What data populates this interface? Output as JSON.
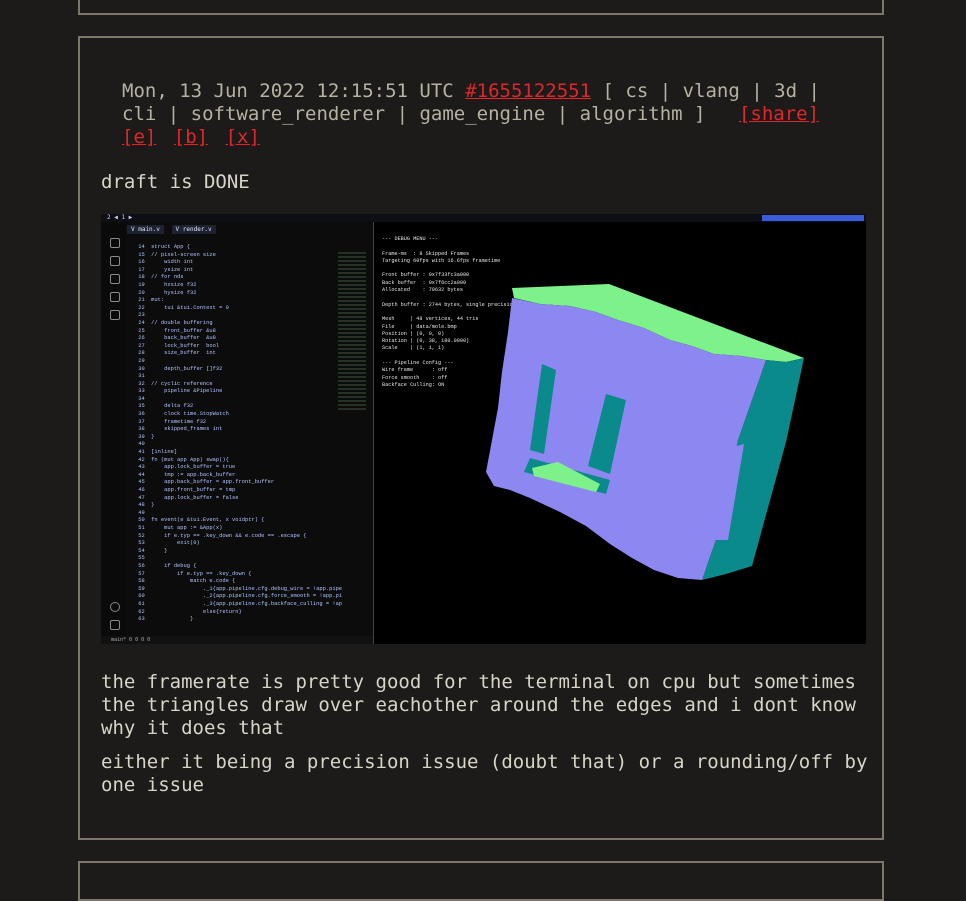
{
  "post": {
    "date": "Mon, 13 Jun 2022 12:15:51 UTC",
    "id_link": "#1655122551",
    "tags_open": "[",
    "tags": [
      "cs",
      "vlang",
      "3d",
      "cli",
      "software_renderer",
      "game_engine",
      "algorithm"
    ],
    "tags_close": "]",
    "actions": [
      "[share]",
      "[e]",
      "[b]",
      "[x]"
    ],
    "paragraphs": [
      "draft is DONE",
      "the framerate is pretty good for the terminal on cpu but sometimes the triangles draw over eachother around the edges and i dont know why it does that",
      "either it being a precision issue (doubt that) or a rounding/off by one issue"
    ]
  },
  "screenshot": {
    "editor_tabs": [
      "V main.v",
      "V render.v"
    ],
    "code_lines": [
      "struct App {",
      "// pixel-screen size",
      "    width int",
      "    ysize int",
      "// for nds",
      "    hxsize f32",
      "    hysize f32",
      "mut:",
      "    tui &tui.Context = 0",
      "",
      "// double buffering",
      "    front_buffer &u8",
      "    back_buffer  &u8",
      "    lock_buffer  bool",
      "    size_buffer  int",
      "",
      "    depth_buffer []f32",
      "",
      "// cyclic reference",
      "    pipeline &Pipeline",
      "",
      "    delta f32",
      "    clock time.StopWatch",
      "    frametime f32",
      "    skipped_frames int",
      "}",
      "",
      "[inline]",
      "fn (mut app App) swap(){",
      "    app.lock_buffer = true",
      "    tmp := app.back_buffer",
      "    app.back_buffer = app.front_buffer",
      "    app.front_buffer = tmp",
      "    app.lock_buffer = false",
      "}",
      "",
      "fn event(e &tui.Event, x voidptr) {",
      "    mut app := &App(x)",
      "    if e.typ == .key_down && e.code == .escape {",
      "        exit(0)",
      "    }",
      "",
      "    if debug {",
      "        if e.typ == .key_down {",
      "            match e.code {",
      "                ._1{app.pipeline.cfg.debug_wire = !app.pipe",
      "                ._2{app.pipeline.cfg.force_smooth = !app.pi",
      "                ._3{app.pipeline.cfg.backface_culling = !ap",
      "                else{return}",
      "            }"
    ],
    "terminal_lines": [
      "--- DEBUG MENU ---",
      "",
      "Frame-ms  : 8 Skipped Frames",
      "Targeting 60fps with 16.6fps frametime",
      "",
      "Front buffer : 0x7f33fc3a000",
      "Back buffer  : 0x7f6cc2a000",
      "Allocated    : 79632 bytes",
      "",
      "Depth buffer : 2744 bytes, single precision",
      "",
      "Mesh     | 48 vertices, 44 tris",
      "File     | data/mole.bmp",
      "Position | (0, 0, 0)",
      "Rotation | (0, 38, 180.0000)",
      "Scale    | (1, 1, 1)",
      "",
      "--- Pipeline Config ---",
      "Wire frame      : off",
      "Force smooth    : off",
      "Backface Culling: ON"
    ],
    "status_text": "main* 0 0 0 0",
    "colors": {
      "face_front": "#8d87f2",
      "face_side": "#0b8a8b",
      "face_top": "#7ef28a"
    }
  }
}
